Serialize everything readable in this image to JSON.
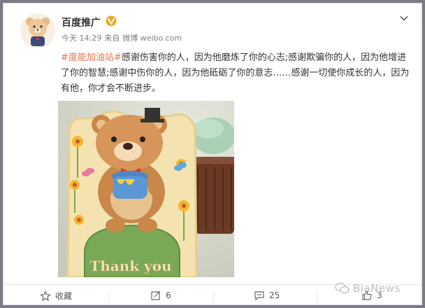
{
  "post": {
    "author": "百度推广",
    "time": "今天 14:29",
    "source_prefix": "来自",
    "source": "微博 weibo.com",
    "hashtag": "#度能加油站#",
    "body": "感谢伤害你的人，因为他磨炼了你的心志;感谢欺骗你的人，因为他增进了你的智慧;感谢中伤你的人，因为他砥砺了你的意志……感谢一切使你成长的人，因为有他，你才会不断进步。",
    "image_caption": "Thank you"
  },
  "actions": {
    "favorite_label": "收藏",
    "repost_count": "6",
    "comment_count": "25",
    "like_count": "3"
  },
  "watermark": "BiaNews",
  "icons": [
    "avatar-bear",
    "verified-v-icon",
    "chevron-down-icon",
    "star-icon",
    "repost-icon",
    "comment-icon",
    "thumbs-up-icon",
    "wechat-icon"
  ],
  "colors": {
    "hashtag": "#eb7350",
    "verified": "#f5a623",
    "text": "#333333",
    "meta": "#808080"
  }
}
